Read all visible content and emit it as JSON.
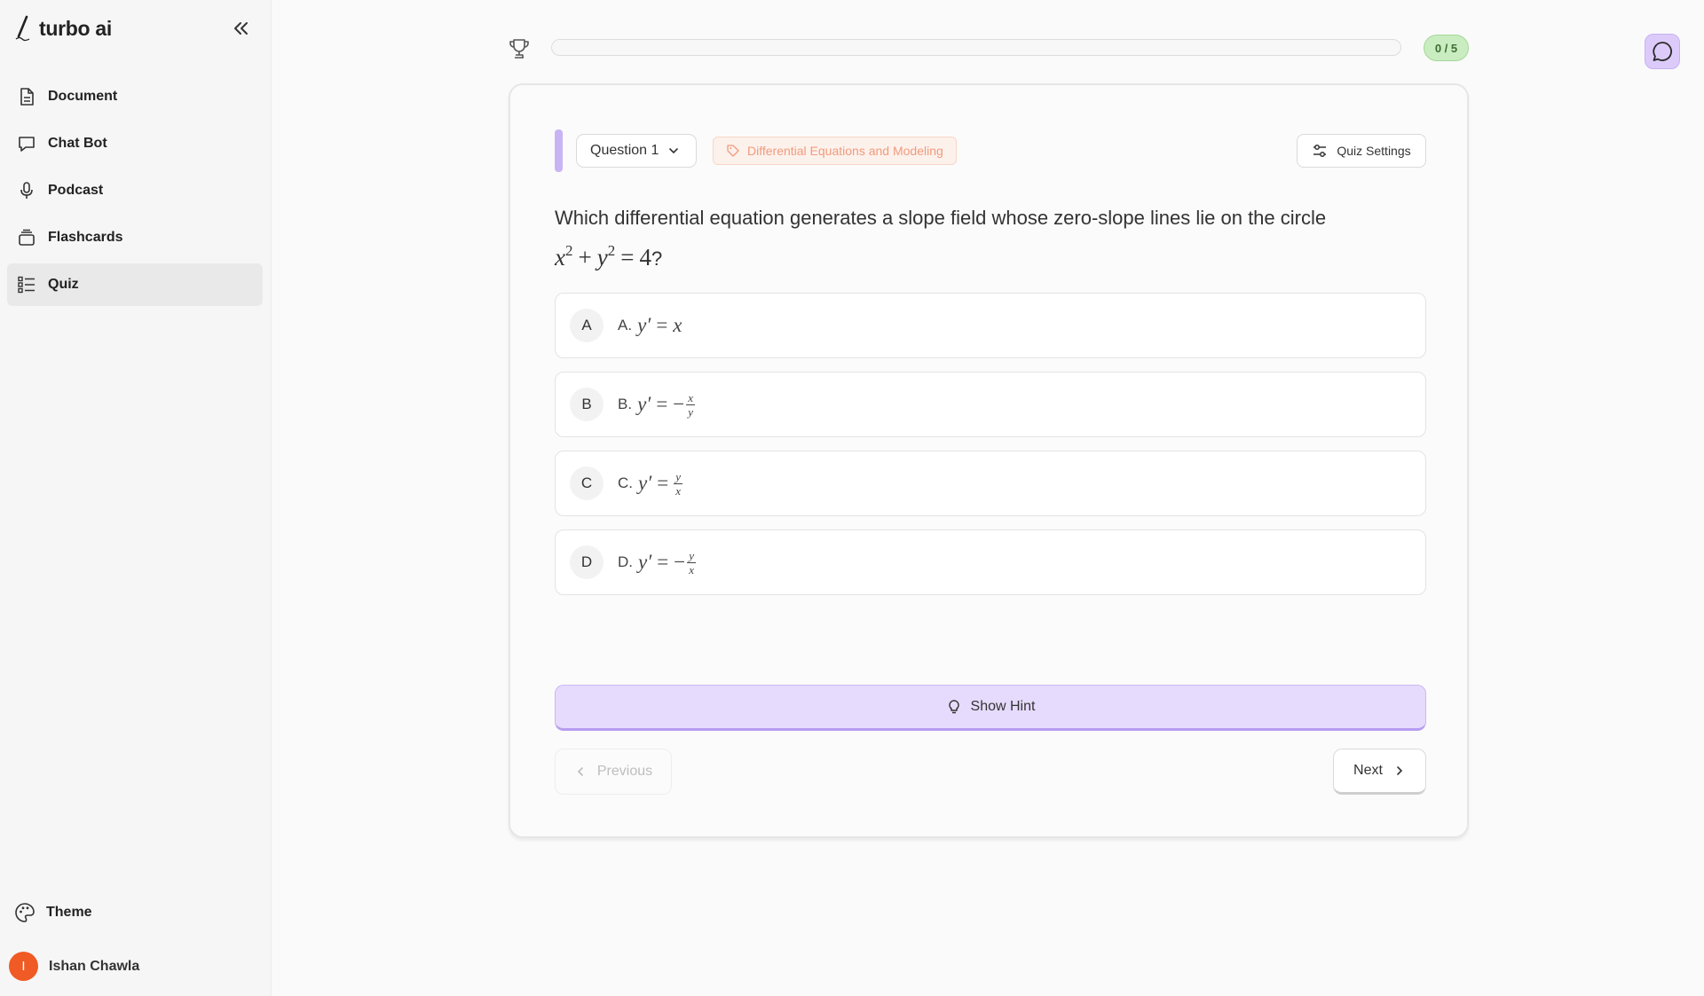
{
  "app": {
    "brand": "turbo ai"
  },
  "sidebar": {
    "items": [
      {
        "label": "Document",
        "icon": "document-icon"
      },
      {
        "label": "Chat Bot",
        "icon": "chat-bubble-icon"
      },
      {
        "label": "Podcast",
        "icon": "microphone-icon"
      },
      {
        "label": "Flashcards",
        "icon": "flashcards-icon"
      },
      {
        "label": "Quiz",
        "icon": "list-checks-icon",
        "active": true
      }
    ],
    "theme_label": "Theme",
    "user": {
      "name": "Ishan Chawla",
      "initial": "I",
      "avatar_color": "#f05a24"
    }
  },
  "quiz": {
    "score": "0 / 5",
    "progress": 0,
    "question_label": "Question 1",
    "topic_tag": "Differential Equations and Modeling",
    "settings_label": "Quiz Settings",
    "question_text": "Which differential equation generates a slope field whose zero-slope lines lie on the circle",
    "question_math": {
      "lhs1": "x",
      "exp1": "2",
      "plus": "+",
      "lhs2": "y",
      "exp2": "2",
      "eq": "=",
      "rhs": "4",
      "end": "?"
    },
    "options": [
      {
        "letter": "A",
        "prefix": "A.",
        "lhs": "y′",
        "eq": "=",
        "sign": "",
        "rhs": "x",
        "num": "",
        "den": ""
      },
      {
        "letter": "B",
        "prefix": "B.",
        "lhs": "y′",
        "eq": "=",
        "sign": "−",
        "rhs": "",
        "num": "x",
        "den": "y"
      },
      {
        "letter": "C",
        "prefix": "C.",
        "lhs": "y′",
        "eq": "=",
        "sign": "",
        "rhs": "",
        "num": "y",
        "den": "x"
      },
      {
        "letter": "D",
        "prefix": "D.",
        "lhs": "y′",
        "eq": "=",
        "sign": "−",
        "rhs": "",
        "num": "y",
        "den": "x"
      }
    ],
    "hint_label": "Show Hint",
    "previous_label": "Previous",
    "next_label": "Next"
  },
  "colors": {
    "accent": "#c8b4f4",
    "hint_bg": "#e6dbfc",
    "score_bg": "#c9ecc0",
    "tag_text": "#ef9b7c"
  }
}
